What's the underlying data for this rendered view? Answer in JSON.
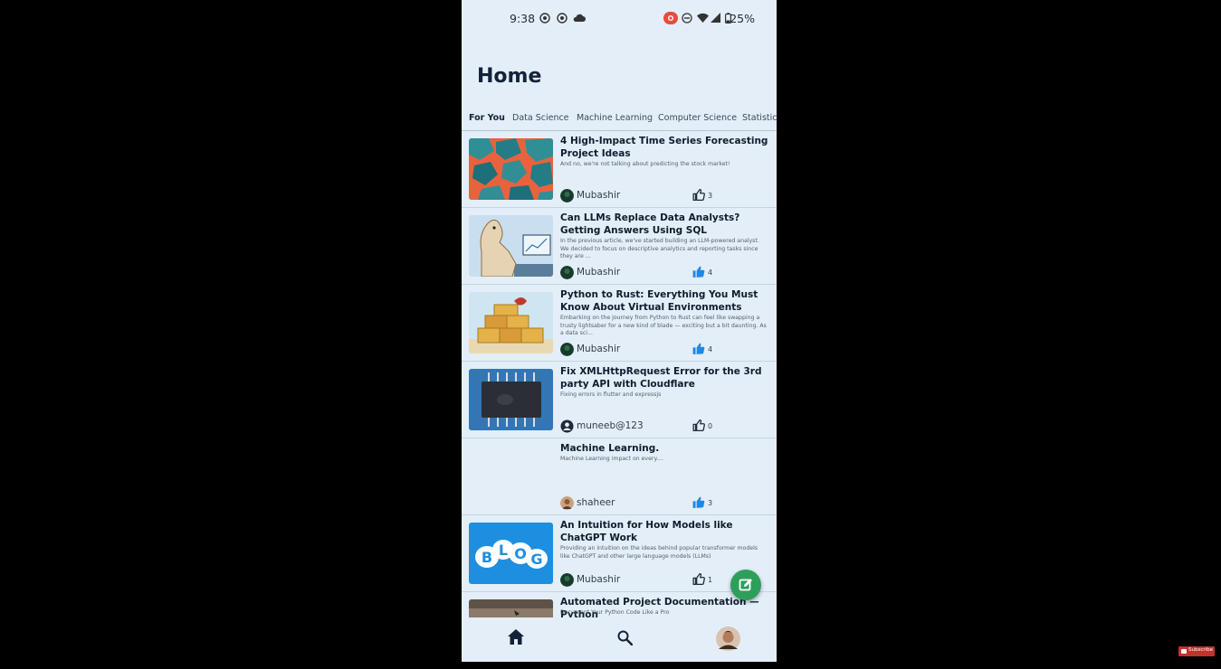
{
  "status_bar": {
    "time": "9:38",
    "battery": "25%"
  },
  "page": {
    "title": "Home"
  },
  "tabs": [
    "For You",
    "Data Science",
    "Machine Learning",
    "Computer Science",
    "Statistics"
  ],
  "posts": [
    {
      "title": "4 High-Impact Time Series Forecasting Project Ideas",
      "description": "And no, we're not talking about predicting the stock market!",
      "author": "Mubashir",
      "likes": "3",
      "liked": false,
      "thumbnail": "colorful-voronoi-pattern"
    },
    {
      "title": "Can LLMs Replace Data Analysts? Getting Answers Using SQL",
      "description": "In the previous article, we've started building an LLM-powered analyst. We decided to focus on descriptive analytics and reporting tasks since they are ...",
      "author": "Mubashir",
      "likes": "4",
      "liked": true,
      "thumbnail": "llama-with-computer"
    },
    {
      "title": "Python to Rust: Everything You Must Know About Virtual Environments",
      "description": "Embarking on the journey from Python to Rust can feel like swapping a trusty lightsaber for a new kind of blade — exciting but a bit daunting. As a data sci...",
      "author": "Mubashir",
      "likes": "4",
      "liked": true,
      "thumbnail": "stacked-containers"
    },
    {
      "title": "Fix XMLHttpRequest Error for the 3rd party API with Cloudflare",
      "description": "Fixing errors in flutter and expressjs",
      "author": "muneeb@123",
      "likes": "0",
      "liked": false,
      "thumbnail": "circuit-chip"
    },
    {
      "title": "Machine Learning.",
      "description": "Machine Learning impact on every....",
      "author": "shaheer",
      "likes": "3",
      "liked": true,
      "thumbnail": "none"
    },
    {
      "title": "An Intuition for How Models like ChatGPT Work",
      "description": "Providing an intuition on the ideas behind popular transformer models like ChatGPT and other large language models (LLMs)",
      "author": "Mubashir",
      "likes": "1",
      "liked": false,
      "thumbnail": "blog-bubbles",
      "thumbnail_text": [
        "B",
        "L",
        "O",
        "G"
      ]
    },
    {
      "title": "Automated Project Documentation — Python",
      "description": "Document Your Python Code Like a Pro",
      "author": "",
      "likes": "",
      "liked": false,
      "thumbnail": "desk-photo"
    }
  ],
  "bottom_nav": [
    "home-icon",
    "search-icon",
    "profile-avatar"
  ],
  "colors": {
    "background": "#e3eef8",
    "accent": "#2e9f5a",
    "like_active": "#1e88e5",
    "title": "#13223a"
  },
  "overlay": {
    "subscribe_label": "Subscribe"
  }
}
